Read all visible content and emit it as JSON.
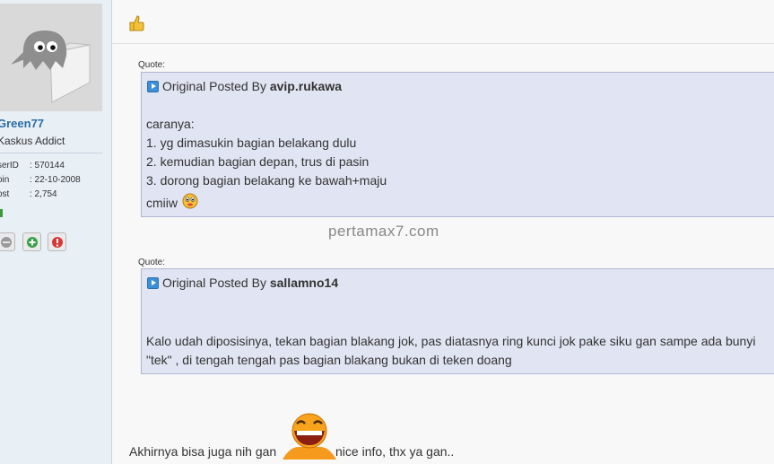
{
  "user": {
    "name": "Green77",
    "title": "Kaskus Addict",
    "stats": [
      {
        "key": "serID",
        "value": ": 570144"
      },
      {
        "key": "oin",
        "value": ": 22-10-2008"
      },
      {
        "key": "ost",
        "value": ": 2,754"
      }
    ]
  },
  "quotes": [
    {
      "label": "Quote:",
      "prefix": "Original Posted By",
      "author": "avip.rukawa",
      "lines": [
        "caranya:",
        "1. yg dimasukin bagian belakang dulu",
        "2. kemudian bagian depan, trus di pasin",
        "3. dorong bagian belakang ke bawah+maju",
        "cmiiw"
      ]
    },
    {
      "label": "Quote:",
      "prefix": "Original Posted By",
      "author": "sallamno14",
      "lines": [
        "Kalo udah diposisinya, tekan bagian blakang jok, pas diatasnya ring kunci jok pake siku gan sampe ada bunyi",
        "\"tek\" , di tengah tengah pas bagian blakang bukan di teken doang"
      ]
    }
  ],
  "watermark": "pertamax7.com",
  "reply": {
    "before": "Akhirnya bisa juga nih gan",
    "after": "nice info, thx ya gan.."
  }
}
